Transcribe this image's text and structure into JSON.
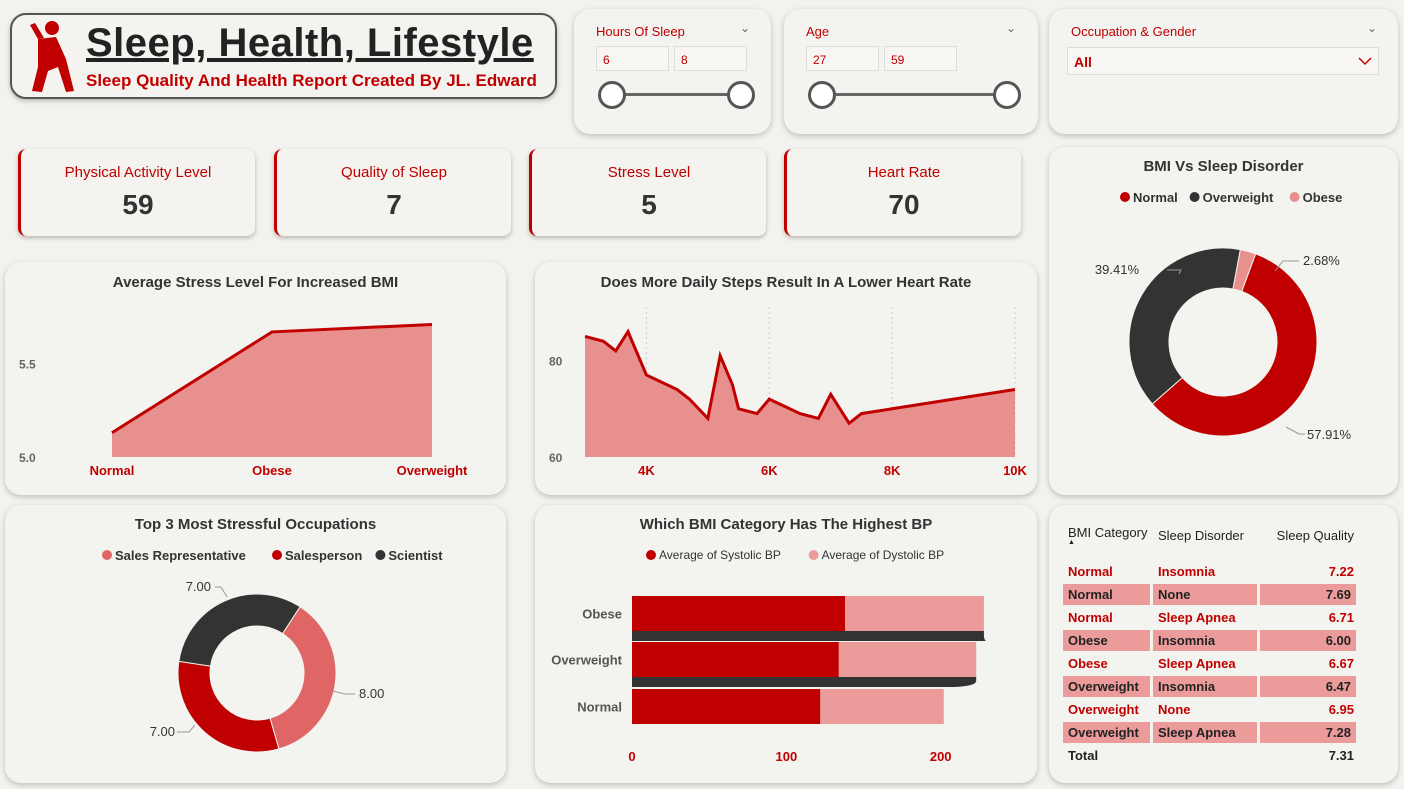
{
  "header": {
    "title": "Sleep, Health, Lifestyle",
    "subtitle": "Sleep Quality And Health Report Created By JL. Edward"
  },
  "slicers": {
    "hours": {
      "title": "Hours Of Sleep",
      "min": "6",
      "max": "8"
    },
    "age": {
      "title": "Age",
      "min": "27",
      "max": "59"
    },
    "occupation": {
      "title": "Occupation & Gender",
      "value": "All"
    }
  },
  "kpis": [
    {
      "label": "Physical Activity Level",
      "value": "59"
    },
    {
      "label": "Quality of Sleep",
      "value": "7"
    },
    {
      "label": "Stress Level",
      "value": "5"
    },
    {
      "label": "Heart Rate",
      "value": "70"
    }
  ],
  "colors": {
    "accent": "#c00000",
    "pink": "#e8908d",
    "dark": "#333333",
    "lightpink": "#ec9b9b"
  },
  "chart_data": [
    {
      "id": "stress_bmi",
      "type": "area",
      "title": "Average Stress Level For Increased BMI",
      "categories": [
        "Normal",
        "Obese",
        "Overweight"
      ],
      "values": [
        5.13,
        5.67,
        5.71
      ],
      "yticks": [
        "5.5",
        "5.0"
      ],
      "ylim": [
        5.0,
        5.75
      ]
    },
    {
      "id": "steps_heart",
      "type": "area",
      "title": "Does More Daily Steps Result In A Lower Heart Rate",
      "x": [
        3000,
        3300,
        3500,
        3700,
        4000,
        4500,
        4700,
        5000,
        5200,
        5400,
        5500,
        5800,
        6000,
        6500,
        6800,
        7000,
        7300,
        7500,
        8000,
        10000
      ],
      "y": [
        85,
        84,
        82,
        86,
        77,
        74,
        72,
        68,
        81,
        75,
        70,
        69,
        72,
        69,
        68,
        73,
        67,
        69,
        70,
        74
      ],
      "xticks": [
        "4K",
        "6K",
        "8K",
        "10K"
      ],
      "yticks": [
        "80",
        "60"
      ],
      "ylim": [
        60,
        88
      ]
    },
    {
      "id": "bmi_disorder",
      "type": "pie",
      "title": "BMI Vs Sleep Disorder",
      "labels": [
        "Normal",
        "Overweight",
        "Obese"
      ],
      "values": [
        57.91,
        39.41,
        2.68
      ],
      "value_labels": [
        "57.91%",
        "39.41%",
        "2.68%"
      ]
    },
    {
      "id": "stressful_occ",
      "type": "pie",
      "title": "Top 3 Most Stressful Occupations",
      "labels": [
        "Sales Representative",
        "Salesperson",
        "Scientist"
      ],
      "values": [
        8.0,
        7.0,
        7.0
      ],
      "value_labels": [
        "8.00",
        "7.00",
        "7.00"
      ]
    },
    {
      "id": "bmi_bp",
      "type": "bar",
      "title": "Which BMI Category Has The Highest BP",
      "categories": [
        "Obese",
        "Overweight",
        "Normal"
      ],
      "series": [
        {
          "name": "Average of Systolic BP",
          "values": [
            138,
            134,
            122
          ]
        },
        {
          "name": "Average of Dystolic BP",
          "values": [
            90,
            89,
            80
          ]
        }
      ],
      "xticks": [
        "0",
        "100",
        "200"
      ],
      "xlim": [
        0,
        230
      ]
    },
    {
      "id": "sleep_table",
      "type": "table",
      "columns": [
        "BMI Category",
        "Sleep Disorder",
        "Sleep Quality"
      ],
      "rows": [
        [
          "Normal",
          "Insomnia",
          "7.22"
        ],
        [
          "Normal",
          "None",
          "7.69"
        ],
        [
          "Normal",
          "Sleep Apnea",
          "6.71"
        ],
        [
          "Obese",
          "Insomnia",
          "6.00"
        ],
        [
          "Obese",
          "Sleep Apnea",
          "6.67"
        ],
        [
          "Overweight",
          "Insomnia",
          "6.47"
        ],
        [
          "Overweight",
          "None",
          "6.95"
        ],
        [
          "Overweight",
          "Sleep Apnea",
          "7.28"
        ]
      ],
      "total": [
        "Total",
        "",
        "7.31"
      ]
    }
  ]
}
